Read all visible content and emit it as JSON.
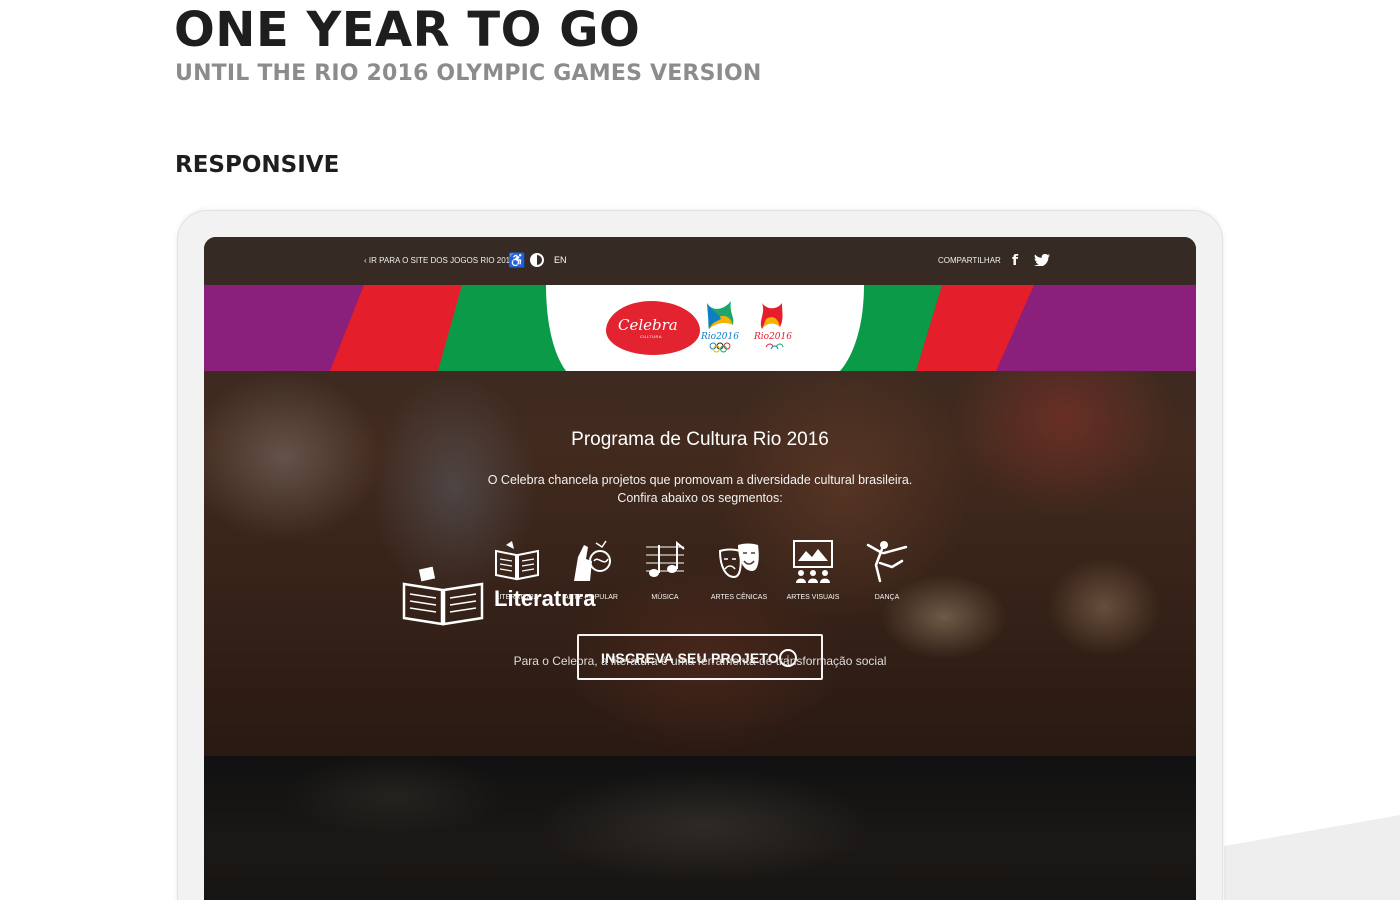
{
  "header": {
    "title": "ONE YEAR TO GO",
    "subtitle": "UNTIL THE RIO 2016 OLYMPIC GAMES VERSION",
    "section_title": "RESPONSIVE"
  },
  "site": {
    "topbar": {
      "link": "‹ IR PARA O SITE DOS JOGOS RIO 2016",
      "language": "EN",
      "share_label": "COMPARTILHAR",
      "icons": [
        "accessibility-icon",
        "contrast-icon",
        "facebook-icon",
        "twitter-icon"
      ]
    },
    "logos": {
      "celebra": "Celebra",
      "celebra_sub": "CULTURA",
      "rio_olympic": "Rio2016",
      "rio_paralympic": "Rio2016"
    },
    "band_colors": [
      "#8b1f7c",
      "#e41e2a",
      "#0a9a48",
      "#ffffff"
    ],
    "hero": {
      "title": "Programa de Cultura Rio 2016",
      "text_line1": "O Celebra chancela projetos que promovam a diversidade cultural brasileira.",
      "text_line2": "Confira abaixo os segmentos:"
    },
    "segments": [
      {
        "label": "LITERATURA",
        "icon": "book-icon"
      },
      {
        "label": "ARTE POPULAR",
        "icon": "folk-art-icon"
      },
      {
        "label": "MÚSICA",
        "icon": "music-icon"
      },
      {
        "label": "ARTES CÊNICAS",
        "icon": "theater-masks-icon"
      },
      {
        "label": "ARTES VISUAIS",
        "icon": "visual-arts-icon"
      },
      {
        "label": "DANÇA",
        "icon": "dance-icon"
      }
    ],
    "cta": {
      "label": "INSCREVA SEU PROJETO",
      "icon": "arrow-down-circle-icon"
    },
    "lower": {
      "title": "Literatura",
      "icon": "book-icon",
      "text": "Para o Celebra, a literatura é uma ferramenta de transformação social"
    }
  }
}
